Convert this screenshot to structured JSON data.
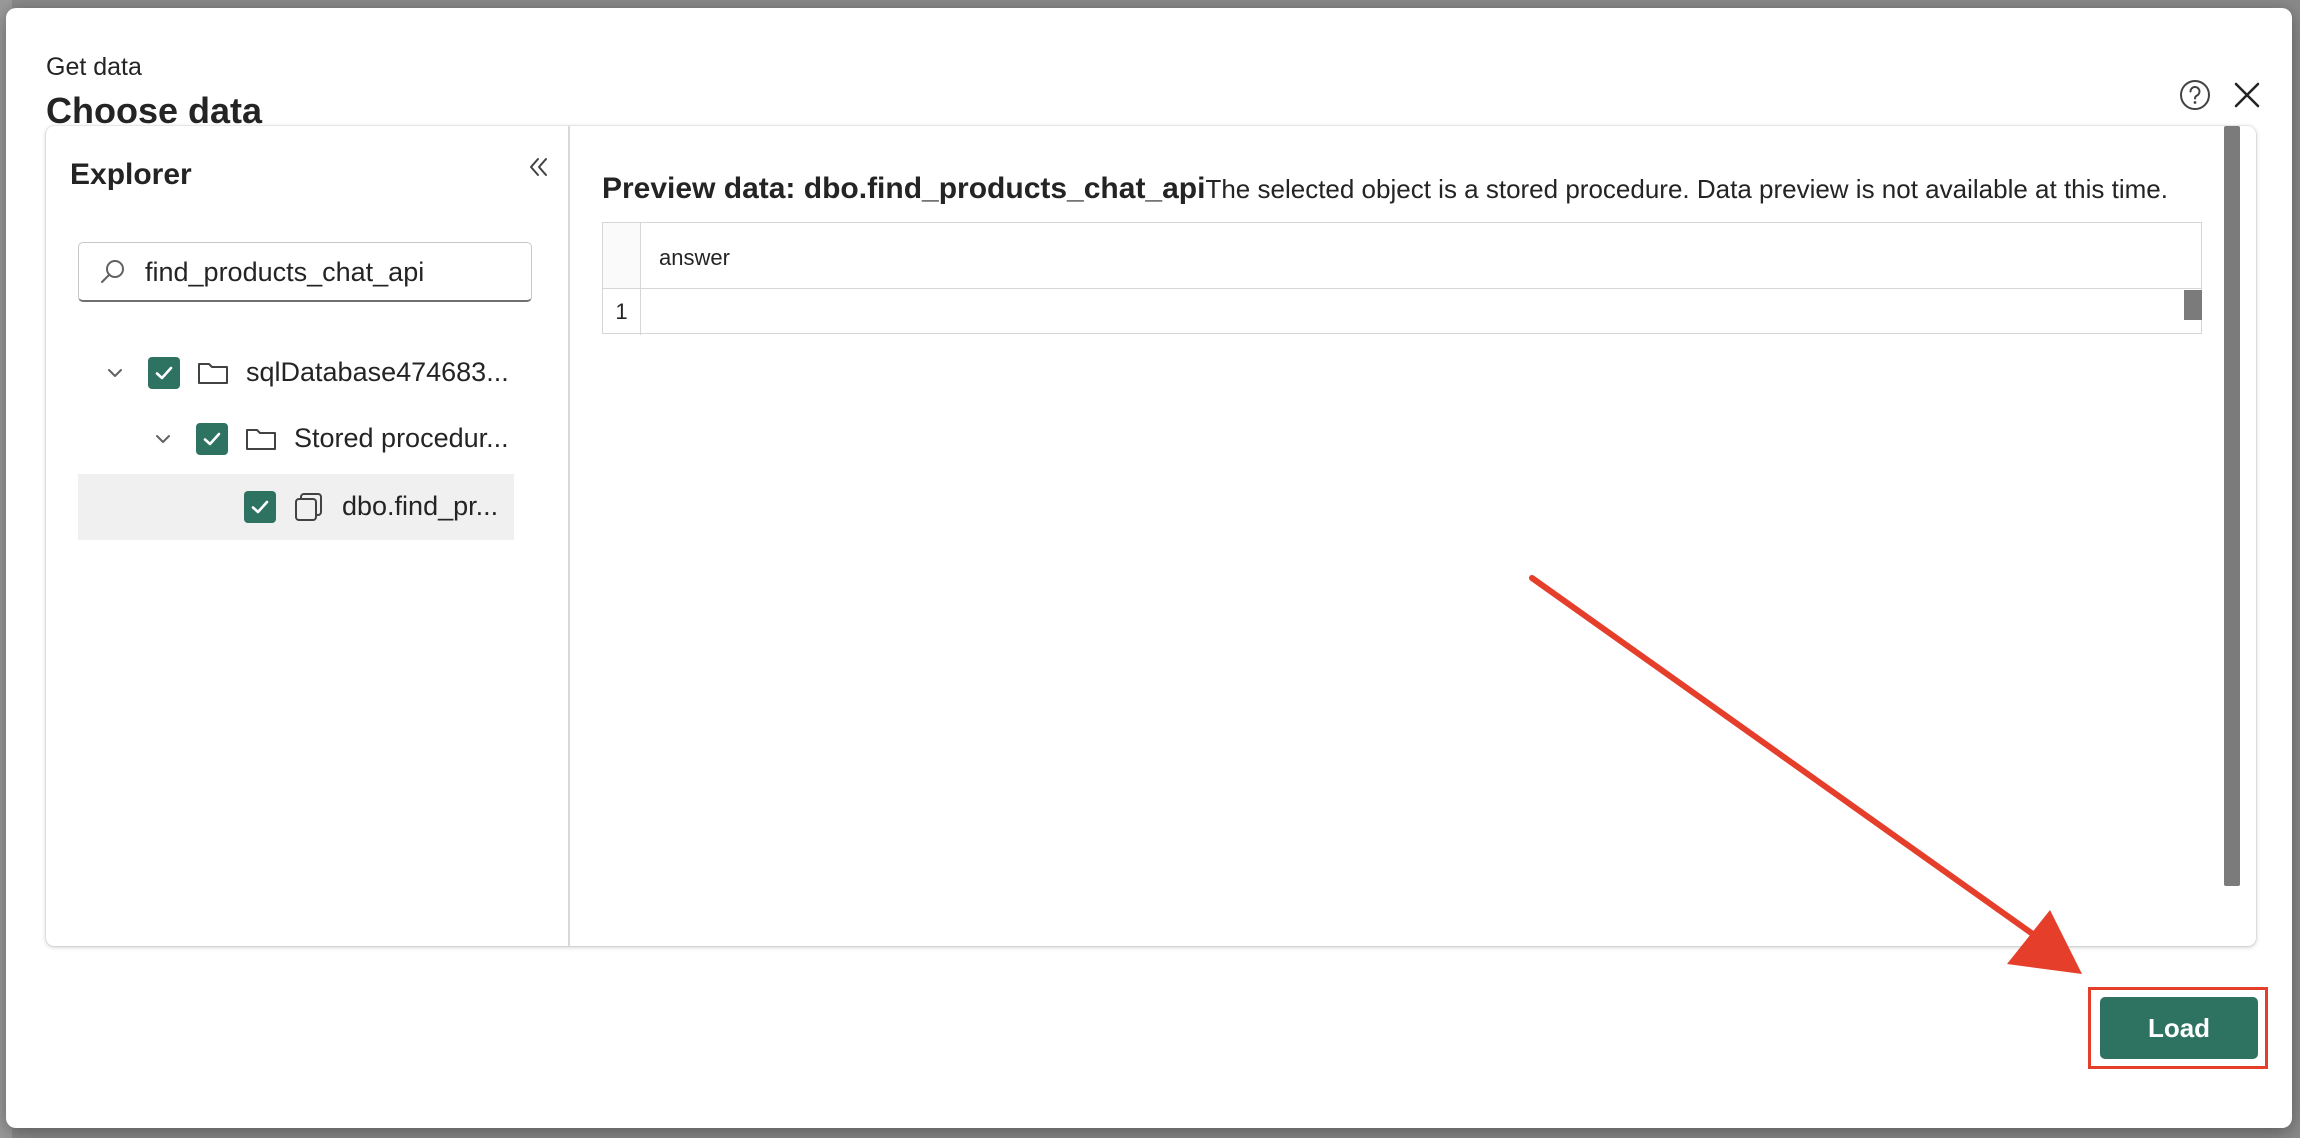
{
  "dialog": {
    "subtitle": "Get data",
    "title": "Choose data"
  },
  "explorer": {
    "title": "Explorer",
    "search": {
      "value": "find_products_chat_api",
      "placeholder": ""
    },
    "tree": [
      {
        "label": "sqlDatabase474683...",
        "checked": true,
        "expanded": true,
        "icon": "folder-icon"
      },
      {
        "label": "Stored procedur...",
        "checked": true,
        "expanded": true,
        "icon": "folder-icon"
      },
      {
        "label": "dbo.find_pr...",
        "checked": true,
        "selected": true,
        "icon": "stored-procedure-icon"
      }
    ]
  },
  "preview": {
    "heading": "Preview data: dbo.find_products_chat_api",
    "note": "The selected object is a stored procedure. Data preview is not available at this time.",
    "columns": [
      "answer"
    ],
    "rows": [
      {
        "num": "1",
        "answer": ""
      }
    ]
  },
  "footer": {
    "load_label": "Load"
  },
  "colors": {
    "accent": "#2e7261",
    "annotation_red": "#e53e2b"
  }
}
